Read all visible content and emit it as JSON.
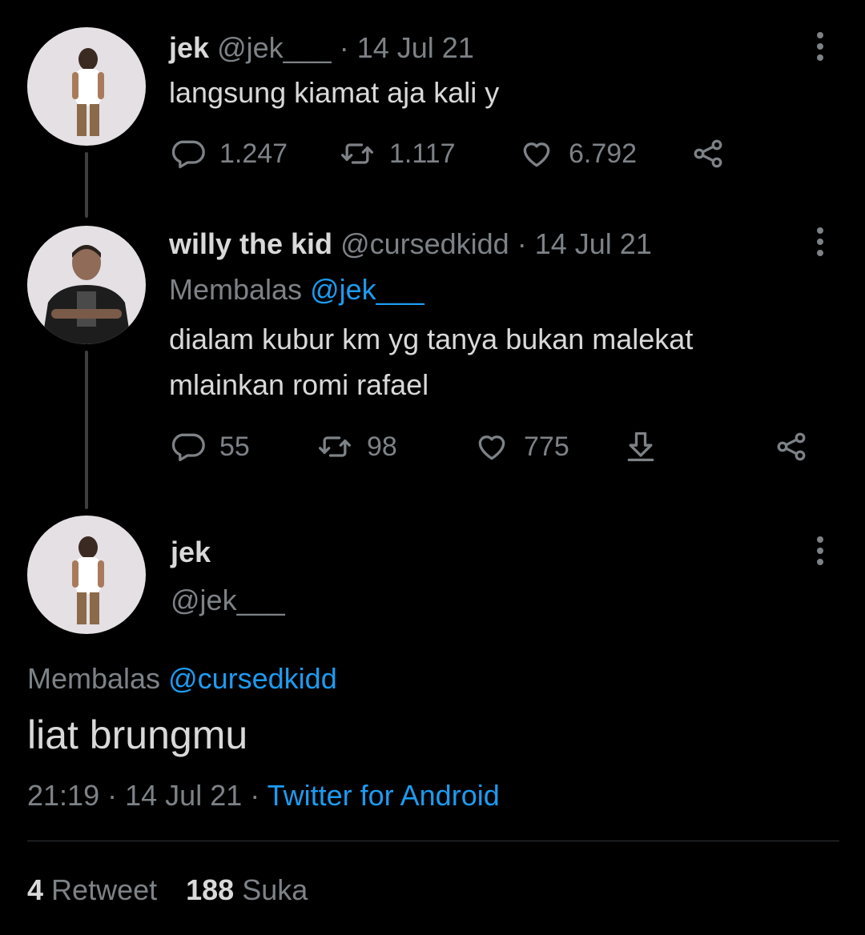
{
  "tweet1": {
    "name": "jek",
    "handle": "@jek___",
    "separator": "·",
    "date": "14 Jul 21",
    "text": "langsung kiamat aja kali y",
    "replies": "1.247",
    "retweets": "1.117",
    "likes": "6.792"
  },
  "tweet2": {
    "name": "willy the kid",
    "handle": "@cursedkidd",
    "separator": "·",
    "date": "14 Jul 21",
    "reply_prefix": "Membalas",
    "reply_to": "@jek___",
    "text_line1": "dialam kubur km yg tanya bukan malekat",
    "text_line2": "mlainkan romi rafael",
    "replies": "55",
    "retweets": "98",
    "likes": "775"
  },
  "tweet3": {
    "name": "jek",
    "handle": "@jek___",
    "reply_prefix": "Membalas",
    "reply_to": "@cursedkidd",
    "text": "liat brungmu",
    "time": "21:19",
    "separator": "·",
    "date": "14 Jul 21",
    "source": "Twitter for Android",
    "retweet_count": "4",
    "retweet_label": "Retweet",
    "like_count": "188",
    "like_label": "Suka"
  },
  "icons": {
    "reply": "reply-bubble-icon",
    "retweet": "retweet-arrows-icon",
    "like": "heart-icon",
    "share": "share-nodes-icon",
    "download": "download-arrow-icon",
    "more": "vertical-ellipsis-icon"
  },
  "colors": {
    "background": "#000000",
    "primary_text": "#d9d9d9",
    "secondary_text": "#7d8287",
    "link": "#1d9bf0"
  }
}
